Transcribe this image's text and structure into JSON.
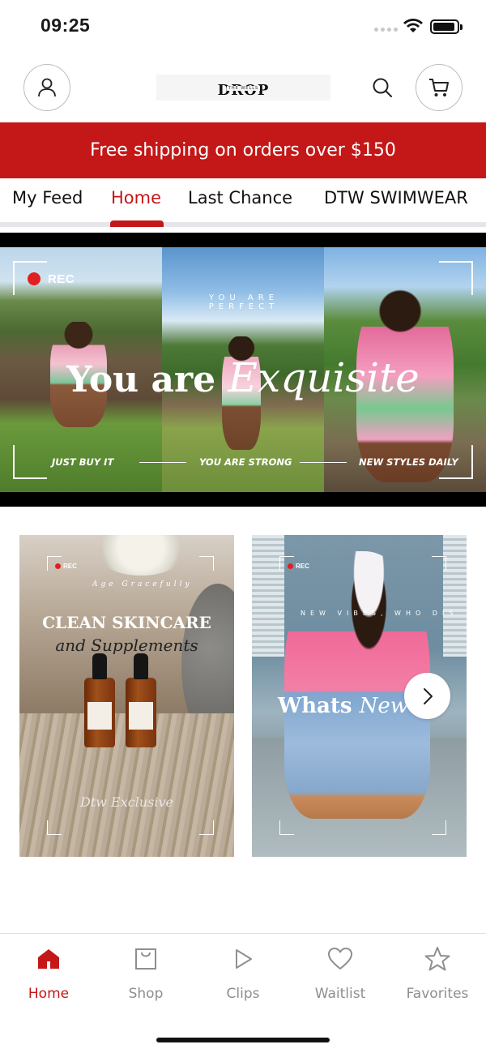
{
  "status_bar": {
    "time": "09:25"
  },
  "header": {
    "logo_text": "DROP",
    "logo_subtext": "THE WELLS"
  },
  "promo_banner": {
    "text": "Free shipping on orders over $150"
  },
  "tabs": [
    {
      "label": "My Feed",
      "active": false
    },
    {
      "label": "Home",
      "active": true
    },
    {
      "label": "Last Chance",
      "active": false
    },
    {
      "label": "DTW SWIMWEAR",
      "active": false
    }
  ],
  "hero": {
    "rec_label": "REC",
    "arc_text": "YOU ARE PERFECT",
    "title_part1": "You are",
    "title_part2": "Exquisite",
    "captions": [
      "JUST BUY IT",
      "YOU ARE STRONG",
      "NEW STYLES DAILY"
    ]
  },
  "cards": [
    {
      "rec_label": "REC",
      "arc_text": "Age Gracefully",
      "title": "CLEAN SKINCARE",
      "subtitle": "and Supplements",
      "signature": "Dtw Exclusive"
    },
    {
      "rec_label": "REC",
      "arc_text": "NEW VIBES, WHO DIS",
      "title_part1": "Whats",
      "title_part2": "New"
    }
  ],
  "bottom_nav": [
    {
      "label": "Home",
      "icon": "home-icon",
      "active": true
    },
    {
      "label": "Shop",
      "icon": "shopping-bag-icon",
      "active": false
    },
    {
      "label": "Clips",
      "icon": "play-icon",
      "active": false
    },
    {
      "label": "Waitlist",
      "icon": "heart-icon",
      "active": false
    },
    {
      "label": "Favorites",
      "icon": "star-icon",
      "active": false
    }
  ],
  "colors": {
    "accent": "#c41717",
    "inactive_nav": "#8e8e93",
    "background": "#ffffff"
  }
}
